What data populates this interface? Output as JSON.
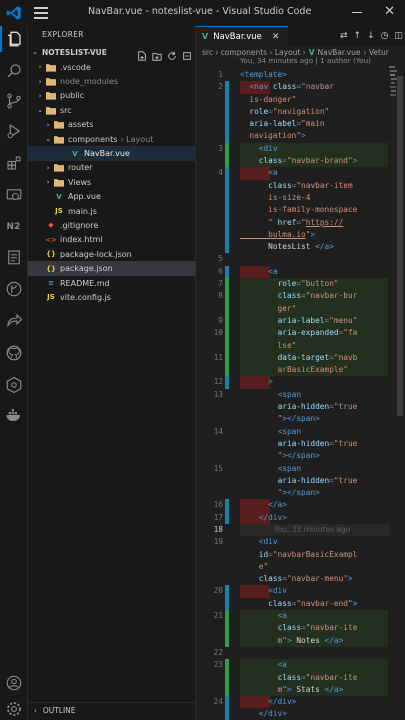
{
  "window": {
    "title": "NavBar.vue - noteslist-vue - Visual Studio Code"
  },
  "explorer": {
    "header": "EXPLORER",
    "project": "NOTESLIST-VUE",
    "items": [
      {
        "label": ".vscode",
        "kind": "folder",
        "depth": 1,
        "chev": "›",
        "muted": false
      },
      {
        "label": "node_modules",
        "kind": "folder",
        "depth": 1,
        "chev": "›",
        "muted": true
      },
      {
        "label": "public",
        "kind": "folder",
        "depth": 1,
        "chev": "›",
        "muted": false
      },
      {
        "label": "src",
        "kind": "folder",
        "depth": 1,
        "chev": "⌄",
        "muted": false
      },
      {
        "label": "assets",
        "kind": "folder",
        "depth": 2,
        "chev": "›",
        "muted": false
      },
      {
        "label": "components",
        "crumb": "Layout",
        "kind": "folder",
        "depth": 2,
        "chev": "⌄",
        "muted": false
      },
      {
        "label": "NavBar.vue",
        "kind": "vue",
        "depth": 4,
        "chev": "",
        "muted": false,
        "active": true
      },
      {
        "label": "router",
        "kind": "folder",
        "depth": 2,
        "chev": "›",
        "muted": false
      },
      {
        "label": "Views",
        "kind": "folder",
        "depth": 2,
        "chev": "›",
        "muted": false
      },
      {
        "label": "App.vue",
        "kind": "vue",
        "depth": 2,
        "chev": "",
        "muted": false
      },
      {
        "label": "main.js",
        "kind": "js",
        "depth": 2,
        "chev": "",
        "muted": false
      },
      {
        "label": ".gitignore",
        "kind": "git",
        "depth": 1,
        "chev": "",
        "muted": false
      },
      {
        "label": "index.html",
        "kind": "html",
        "depth": 1,
        "chev": "",
        "muted": false
      },
      {
        "label": "package-lock.json",
        "kind": "json",
        "depth": 1,
        "chev": "",
        "muted": false
      },
      {
        "label": "package.json",
        "kind": "json",
        "depth": 1,
        "chev": "",
        "muted": false,
        "selected": true
      },
      {
        "label": "README.md",
        "kind": "md",
        "depth": 1,
        "chev": "",
        "muted": false
      },
      {
        "label": "vite.config.js",
        "kind": "js",
        "depth": 1,
        "chev": "",
        "muted": false
      }
    ],
    "outline": "OUTLINE"
  },
  "editor": {
    "tab_label": "NavBar.vue",
    "breadcrumb": {
      "path": "src › components › Layout ›",
      "file": "NavBar.vue",
      "rest": "› Vetur"
    },
    "blame_header": "You, 34 minutes ago | 1 author (You)",
    "blame_inline": "You, 33 minutes ago"
  },
  "code_lines": [
    {
      "ln": "1",
      "mark": "",
      "bg": "",
      "parts": [
        [
          "tag",
          "<template>"
        ]
      ]
    },
    {
      "ln": "2",
      "mark": "mod",
      "bg": "del",
      "parts": [
        [
          "plain",
          "  "
        ],
        [
          "tag",
          "<nav "
        ],
        [
          "attr",
          "class"
        ],
        [
          "pun",
          "="
        ],
        [
          "str",
          "\"navbar"
        ]
      ]
    },
    {
      "ln": "",
      "mark": "mod",
      "bg": "",
      "parts": [
        [
          "str",
          "  is-danger\""
        ]
      ]
    },
    {
      "ln": "",
      "mark": "mod",
      "bg": "",
      "parts": [
        [
          "plain",
          "  "
        ],
        [
          "attr",
          "role"
        ],
        [
          "pun",
          "="
        ],
        [
          "str",
          "\"navigation\""
        ]
      ]
    },
    {
      "ln": "",
      "mark": "mod",
      "bg": "",
      "parts": [
        [
          "plain",
          "  "
        ],
        [
          "attr",
          "aria-label"
        ],
        [
          "pun",
          "="
        ],
        [
          "str",
          "\"main"
        ]
      ]
    },
    {
      "ln": "",
      "mark": "mod",
      "bg": "",
      "parts": [
        [
          "str",
          "  navigation\""
        ],
        [
          "tag",
          ">"
        ]
      ]
    },
    {
      "ln": "3",
      "mark": "add",
      "bg": "ins",
      "parts": [
        [
          "plain",
          "    "
        ],
        [
          "tag",
          "<div"
        ]
      ]
    },
    {
      "ln": "",
      "mark": "add",
      "bg": "ins",
      "parts": [
        [
          "plain",
          "    "
        ],
        [
          "attr",
          "class"
        ],
        [
          "pun",
          "="
        ],
        [
          "str",
          "\"navbar-brand\""
        ],
        [
          "tag",
          ">"
        ]
      ]
    },
    {
      "ln": "4",
      "mark": "mod",
      "bg": "del",
      "parts": [
        [
          "plain",
          "      "
        ],
        [
          "tag",
          "<a"
        ]
      ]
    },
    {
      "ln": "",
      "mark": "mod",
      "bg": "",
      "parts": [
        [
          "plain",
          "      "
        ],
        [
          "attr",
          "class"
        ],
        [
          "pun",
          "="
        ],
        [
          "str",
          "\"navbar-item"
        ]
      ]
    },
    {
      "ln": "",
      "mark": "mod",
      "bg": "",
      "parts": [
        [
          "str",
          "      is-size-4"
        ]
      ]
    },
    {
      "ln": "",
      "mark": "mod",
      "bg": "",
      "parts": [
        [
          "str",
          "      is-family-monospace"
        ]
      ]
    },
    {
      "ln": "",
      "mark": "mod",
      "bg": "",
      "parts": [
        [
          "str",
          "      \" "
        ],
        [
          "attr",
          "href"
        ],
        [
          "pun",
          "="
        ],
        [
          "str",
          "\""
        ],
        [
          "link",
          "https://"
        ]
      ]
    },
    {
      "ln": "",
      "mark": "mod",
      "bg": "",
      "parts": [
        [
          "link",
          "      bulma.io"
        ],
        [
          "str",
          "\""
        ],
        [
          "tag",
          ">"
        ]
      ]
    },
    {
      "ln": "",
      "mark": "mod",
      "bg": "",
      "parts": [
        [
          "plain",
          "      NotesList "
        ],
        [
          "tag",
          "</a>"
        ]
      ]
    },
    {
      "ln": "5",
      "mark": "",
      "bg": "",
      "parts": []
    },
    {
      "ln": "6",
      "mark": "mod",
      "bg": "del",
      "parts": [
        [
          "plain",
          "      "
        ],
        [
          "tag",
          "<a"
        ]
      ]
    },
    {
      "ln": "7",
      "mark": "add",
      "bg": "ins",
      "parts": [
        [
          "plain",
          "        "
        ],
        [
          "attr",
          "role"
        ],
        [
          "pun",
          "="
        ],
        [
          "str",
          "\"button\""
        ]
      ]
    },
    {
      "ln": "8",
      "mark": "add",
      "bg": "ins",
      "parts": [
        [
          "plain",
          "        "
        ],
        [
          "attr",
          "class"
        ],
        [
          "pun",
          "="
        ],
        [
          "str",
          "\"navbar-bur"
        ]
      ]
    },
    {
      "ln": "",
      "mark": "add",
      "bg": "ins",
      "parts": [
        [
          "str",
          "        ger\""
        ]
      ]
    },
    {
      "ln": "9",
      "mark": "add",
      "bg": "ins",
      "parts": [
        [
          "plain",
          "        "
        ],
        [
          "attr",
          "aria-label"
        ],
        [
          "pun",
          "="
        ],
        [
          "str",
          "\"menu\""
        ]
      ]
    },
    {
      "ln": "10",
      "mark": "add",
      "bg": "ins",
      "parts": [
        [
          "plain",
          "        "
        ],
        [
          "attr",
          "aria-expanded"
        ],
        [
          "pun",
          "="
        ],
        [
          "str",
          "\"fa"
        ]
      ]
    },
    {
      "ln": "",
      "mark": "add",
      "bg": "ins",
      "parts": [
        [
          "str",
          "        lse\""
        ]
      ]
    },
    {
      "ln": "11",
      "mark": "add",
      "bg": "ins",
      "parts": [
        [
          "plain",
          "        "
        ],
        [
          "attr",
          "data-target"
        ],
        [
          "pun",
          "="
        ],
        [
          "str",
          "\"navb"
        ]
      ]
    },
    {
      "ln": "",
      "mark": "add",
      "bg": "ins",
      "parts": [
        [
          "str",
          "        arBasicExample\""
        ]
      ]
    },
    {
      "ln": "12",
      "mark": "mod",
      "bg": "del",
      "parts": [
        [
          "plain",
          "      "
        ],
        [
          "tag",
          ">"
        ]
      ]
    },
    {
      "ln": "13",
      "mark": "",
      "bg": "",
      "parts": [
        [
          "plain",
          "        "
        ],
        [
          "tag",
          "<span"
        ]
      ]
    },
    {
      "ln": "",
      "mark": "",
      "bg": "",
      "parts": [
        [
          "plain",
          "        "
        ],
        [
          "attr",
          "aria-hidden"
        ],
        [
          "pun",
          "="
        ],
        [
          "str",
          "\"true"
        ]
      ]
    },
    {
      "ln": "",
      "mark": "",
      "bg": "",
      "parts": [
        [
          "str",
          "        \""
        ],
        [
          "tag",
          "></span>"
        ]
      ]
    },
    {
      "ln": "14",
      "mark": "",
      "bg": "",
      "parts": [
        [
          "plain",
          "        "
        ],
        [
          "tag",
          "<span"
        ]
      ]
    },
    {
      "ln": "",
      "mark": "",
      "bg": "",
      "parts": [
        [
          "plain",
          "        "
        ],
        [
          "attr",
          "aria-hidden"
        ],
        [
          "pun",
          "="
        ],
        [
          "str",
          "\"true"
        ]
      ]
    },
    {
      "ln": "",
      "mark": "",
      "bg": "",
      "parts": [
        [
          "str",
          "        \""
        ],
        [
          "tag",
          "></span>"
        ]
      ]
    },
    {
      "ln": "15",
      "mark": "",
      "bg": "",
      "parts": [
        [
          "plain",
          "        "
        ],
        [
          "tag",
          "<span"
        ]
      ]
    },
    {
      "ln": "",
      "mark": "",
      "bg": "",
      "parts": [
        [
          "plain",
          "        "
        ],
        [
          "attr",
          "aria-hidden"
        ],
        [
          "pun",
          "="
        ],
        [
          "str",
          "\"true"
        ]
      ]
    },
    {
      "ln": "",
      "mark": "",
      "bg": "",
      "parts": [
        [
          "str",
          "        \""
        ],
        [
          "tag",
          "></span>"
        ]
      ]
    },
    {
      "ln": "16",
      "mark": "mod",
      "bg": "del",
      "parts": [
        [
          "plain",
          "      "
        ],
        [
          "tag",
          "</a>"
        ]
      ]
    },
    {
      "ln": "17",
      "mark": "mod",
      "bg": "del",
      "parts": [
        [
          "plain",
          "    "
        ],
        [
          "tag",
          "</div>"
        ]
      ]
    },
    {
      "ln": "18",
      "mark": "",
      "bg": "cur",
      "blame": true,
      "parts": []
    },
    {
      "ln": "19",
      "mark": "",
      "bg": "",
      "parts": [
        [
          "plain",
          "    "
        ],
        [
          "tag",
          "<div"
        ]
      ]
    },
    {
      "ln": "",
      "mark": "",
      "bg": "",
      "parts": [
        [
          "plain",
          "    "
        ],
        [
          "attr",
          "id"
        ],
        [
          "pun",
          "="
        ],
        [
          "str",
          "\"navbarBasicExampl"
        ]
      ]
    },
    {
      "ln": "",
      "mark": "",
      "bg": "",
      "parts": [
        [
          "str",
          "    e\""
        ]
      ]
    },
    {
      "ln": "",
      "mark": "",
      "bg": "",
      "parts": [
        [
          "plain",
          "    "
        ],
        [
          "attr",
          "class"
        ],
        [
          "pun",
          "="
        ],
        [
          "str",
          "\"navbar-menu\""
        ],
        [
          "tag",
          ">"
        ]
      ]
    },
    {
      "ln": "20",
      "mark": "mod",
      "bg": "del",
      "parts": [
        [
          "plain",
          "      "
        ],
        [
          "tag",
          "<div"
        ]
      ]
    },
    {
      "ln": "",
      "mark": "mod",
      "bg": "",
      "parts": [
        [
          "plain",
          "      "
        ],
        [
          "attr",
          "class"
        ],
        [
          "pun",
          "="
        ],
        [
          "str",
          "\"navbar-end\""
        ],
        [
          "tag",
          ">"
        ]
      ]
    },
    {
      "ln": "21",
      "mark": "add",
      "bg": "ins",
      "parts": [
        [
          "plain",
          "        "
        ],
        [
          "tag",
          "<a"
        ]
      ]
    },
    {
      "ln": "",
      "mark": "add",
      "bg": "ins",
      "parts": [
        [
          "plain",
          "        "
        ],
        [
          "attr",
          "class"
        ],
        [
          "pun",
          "="
        ],
        [
          "str",
          "\"navbar-ite"
        ]
      ]
    },
    {
      "ln": "",
      "mark": "add",
      "bg": "ins",
      "parts": [
        [
          "str",
          "        m\""
        ],
        [
          "tag",
          ">"
        ],
        [
          "plain",
          " Notes "
        ],
        [
          "tag",
          "</a>"
        ]
      ]
    },
    {
      "ln": "22",
      "mark": "",
      "bg": "",
      "parts": []
    },
    {
      "ln": "23",
      "mark": "add",
      "bg": "ins",
      "parts": [
        [
          "plain",
          "        "
        ],
        [
          "tag",
          "<a"
        ]
      ]
    },
    {
      "ln": "",
      "mark": "add",
      "bg": "ins",
      "parts": [
        [
          "plain",
          "        "
        ],
        [
          "attr",
          "class"
        ],
        [
          "pun",
          "="
        ],
        [
          "str",
          "\"navbar-ite"
        ]
      ]
    },
    {
      "ln": "",
      "mark": "add",
      "bg": "ins",
      "parts": [
        [
          "str",
          "        m\""
        ],
        [
          "tag",
          ">"
        ],
        [
          "plain",
          " Stats "
        ],
        [
          "tag",
          "</a>"
        ]
      ]
    },
    {
      "ln": "24",
      "mark": "mod",
      "bg": "del",
      "parts": [
        [
          "plain",
          "      "
        ],
        [
          "tag",
          "</div>"
        ]
      ]
    },
    {
      "ln": "",
      "mark": "mod",
      "bg": "",
      "parts": [
        [
          "plain",
          "    "
        ],
        [
          "tag",
          "</div>"
        ]
      ]
    }
  ],
  "colors": {
    "accent": "#0078d4",
    "vue_green": "#42b883",
    "git_added": "#2ea043",
    "git_modified": "#1b81a8",
    "git_deleted_bg": "#5a1d1d",
    "folder": "#dcb67a"
  }
}
